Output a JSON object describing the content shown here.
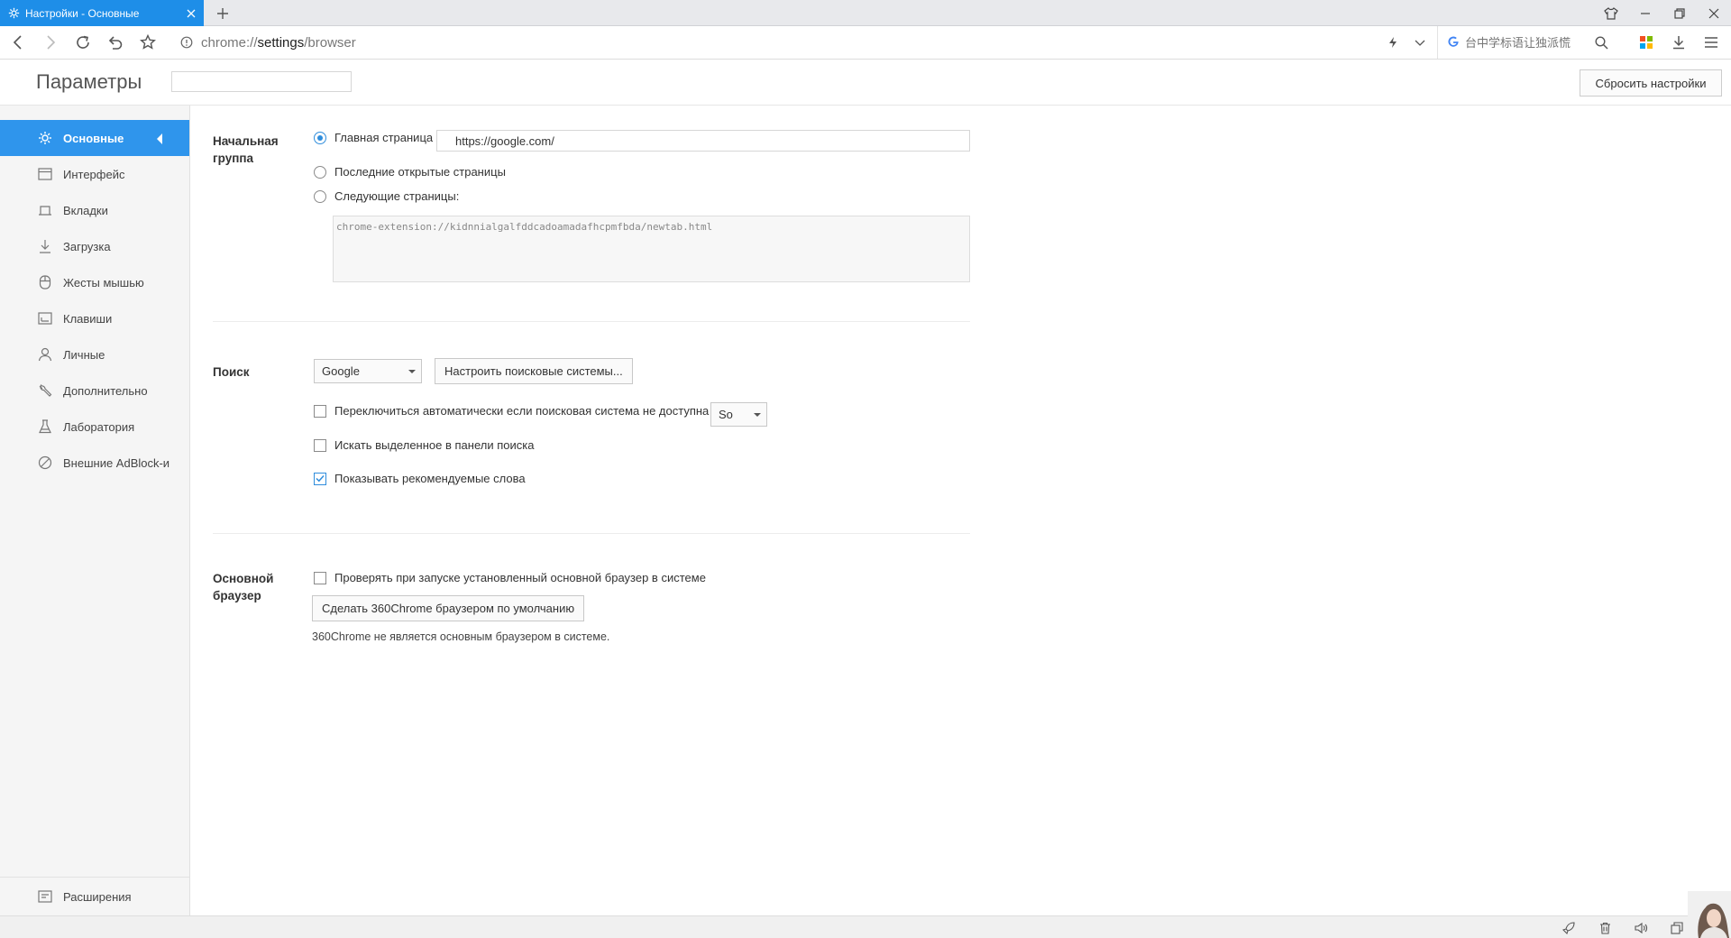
{
  "tab": {
    "title": "Настройки - Основные"
  },
  "address": {
    "url_prefix": "chrome://",
    "url_host": "settings",
    "url_path": "/browser"
  },
  "search_box": {
    "placeholder": "台中学标语让独派慌"
  },
  "header": {
    "title": "Параметры",
    "search_placeholder": "",
    "reset_label": "Сбросить настройки"
  },
  "sidebar": {
    "items": [
      {
        "label": "Основные",
        "icon": "gear-icon",
        "active": true
      },
      {
        "label": "Интерфейс",
        "icon": "window-icon"
      },
      {
        "label": "Вкладки",
        "icon": "tab-icon"
      },
      {
        "label": "Загрузка",
        "icon": "download-icon"
      },
      {
        "label": "Жесты мышью",
        "icon": "mouse-icon"
      },
      {
        "label": "Клавиши",
        "icon": "keyboard-icon"
      },
      {
        "label": "Личные",
        "icon": "person-icon"
      },
      {
        "label": "Дополнительно",
        "icon": "wrench-icon"
      },
      {
        "label": "Лаборатория",
        "icon": "flask-icon"
      },
      {
        "label": "Внешние AdBlock-и",
        "icon": "block-icon"
      }
    ],
    "extensions_label": "Расширения"
  },
  "startup": {
    "label": "Начальная группа",
    "homepage_label": "Главная страница",
    "homepage_value": "https://google.com/",
    "last_pages_label": "Последние открытые страницы",
    "next_pages_label": "Следующие страницы:",
    "pages_value": "chrome-extension://kidnnialgalfddcadoamadafhcpmfbda/newtab.html",
    "selected": "homepage"
  },
  "search": {
    "label": "Поиск",
    "engine": "Google",
    "configure_label": "Настроить поисковые системы...",
    "auto_switch_label": "Переключиться автоматически если поисковая система не доступна",
    "auto_switch_engine": "So",
    "auto_switch_checked": false,
    "search_selected_label": "Искать выделенное в панели поиска",
    "search_selected_checked": false,
    "suggestions_label": "Показывать рекомендуемые слова",
    "suggestions_checked": true
  },
  "default_browser": {
    "label": "Основной браузер",
    "check_label": "Проверять при запуске установленный основной браузер в системе",
    "check_checked": false,
    "make_default_label": "Сделать 360Chrome браузером по умолчанию",
    "status_text": "360Chrome не является основным браузером в системе."
  },
  "colors": {
    "accent": "#2f95ec",
    "tab_active": "#1e8ee8"
  }
}
